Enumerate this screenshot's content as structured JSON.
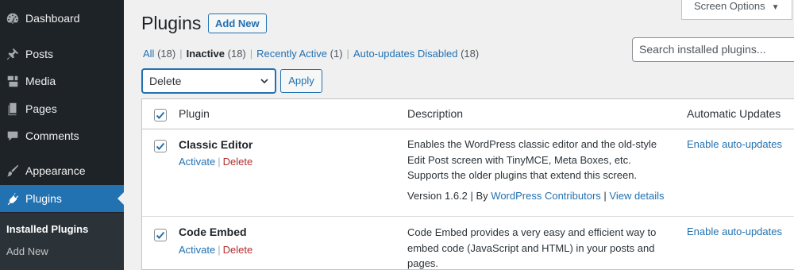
{
  "sidebar": {
    "items": [
      {
        "label": "Dashboard",
        "icon": "dashboard-icon"
      },
      {
        "label": "Posts",
        "icon": "pin-icon"
      },
      {
        "label": "Media",
        "icon": "media-icon"
      },
      {
        "label": "Pages",
        "icon": "page-icon"
      },
      {
        "label": "Comments",
        "icon": "comment-icon"
      },
      {
        "label": "Appearance",
        "icon": "brush-icon"
      },
      {
        "label": "Plugins",
        "icon": "plugin-icon"
      }
    ],
    "submenu": [
      "Installed Plugins",
      "Add New"
    ],
    "active_color": "#2271b1"
  },
  "header": {
    "title": "Plugins",
    "add_new": "Add New",
    "screen_options": "Screen Options"
  },
  "filters": {
    "all": "All",
    "all_count": "(18)",
    "inactive": "Inactive",
    "inactive_count": "(18)",
    "recent": "Recently Active",
    "recent_count": "(1)",
    "autoupd": "Auto-updates Disabled",
    "autoupd_count": "(18)"
  },
  "search": {
    "placeholder": "Search installed plugins..."
  },
  "bulk": {
    "selected": "Delete",
    "apply": "Apply"
  },
  "table": {
    "columns": {
      "plugin": "Plugin",
      "description": "Description",
      "auto": "Automatic Updates"
    },
    "rows": [
      {
        "name": "Classic Editor",
        "activate": "Activate",
        "delete": "Delete",
        "desc": "Enables the WordPress classic editor and the old-style Edit Post screen with TinyMCE, Meta Boxes, etc. Supports the older plugins that extend this screen.",
        "version": "Version 1.6.2",
        "by": "By",
        "author": "WordPress Contributors",
        "details": "View details",
        "auto": "Enable auto-updates"
      },
      {
        "name": "Code Embed",
        "activate": "Activate",
        "delete": "Delete",
        "desc": "Code Embed provides a very easy and efficient way to embed code (JavaScript and HTML) in your posts and pages.",
        "auto": "Enable auto-updates"
      }
    ]
  }
}
